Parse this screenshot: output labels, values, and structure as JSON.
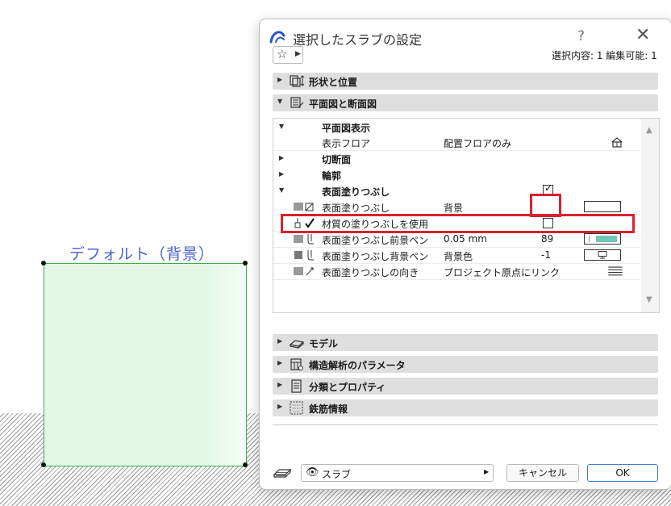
{
  "canvas": {
    "label": "デフォルト（背景）",
    "colors": {
      "label": "#4a62c8",
      "slab_fill": "#e3f8e6",
      "slab_border": "#3fae4a"
    }
  },
  "dialog": {
    "title": "選択したスラブの設定",
    "help": "?",
    "close": "✕",
    "selection_info": "選択内容: 1 編集可能: 1",
    "favorites_star": "☆",
    "sections_top": [
      {
        "label": "形状と位置",
        "expanded": false,
        "icon": "shape-position-icon"
      },
      {
        "label": "平面図と断面図",
        "expanded": true,
        "icon": "floorplan-section-icon"
      }
    ],
    "table": {
      "rows": [
        {
          "type": "group",
          "label": "平面図表示",
          "expanded": true
        },
        {
          "type": "item",
          "label": "表示フロア",
          "value": "配置フロアのみ",
          "icon": "floor-display-icon"
        },
        {
          "type": "group",
          "label": "切断面",
          "expanded": false
        },
        {
          "type": "group",
          "label": "輪郭",
          "expanded": false
        },
        {
          "type": "group",
          "label": "表面塗りつぶし",
          "expanded": true,
          "checked": true
        },
        {
          "type": "item",
          "label": "表面塗りつぶし",
          "value": "背景",
          "icon": "fill-pattern-icon"
        },
        {
          "type": "item",
          "label": "材質の塗りつぶしを使用",
          "value": "",
          "checked": false,
          "icon": "material-fill-icon"
        },
        {
          "type": "item",
          "label": "表面塗りつぶし前景ペン",
          "value": "0.05 mm",
          "number": "89",
          "icon": "foreground-pen-icon"
        },
        {
          "type": "item",
          "label": "表面塗りつぶし背景ペン",
          "value": "背景色",
          "number": "-1",
          "icon": "background-pen-icon"
        },
        {
          "type": "item",
          "label": "表面塗りつぶしの向き",
          "value": "プロジェクト原点にリンク",
          "icon": "fill-orientation-icon"
        }
      ]
    },
    "sections_bottom": [
      {
        "label": "モデル",
        "expanded": false,
        "icon": "model-icon"
      },
      {
        "label": "構造解析のパラメータ",
        "expanded": false,
        "icon": "structural-analysis-icon"
      },
      {
        "label": "分類とプロパティ",
        "expanded": false,
        "icon": "classification-icon"
      },
      {
        "label": "鉄筋情報",
        "expanded": false,
        "icon": "rebar-icon"
      }
    ],
    "footer": {
      "layer_label": "スラブ",
      "cancel_label": "キャンセル",
      "ok_label": "OK"
    },
    "colors": {
      "highlight": "#d8212b",
      "pen_swatch": "#6fc7b8",
      "section_bg": "#dedede",
      "ok_border": "#3d7bd6"
    }
  }
}
